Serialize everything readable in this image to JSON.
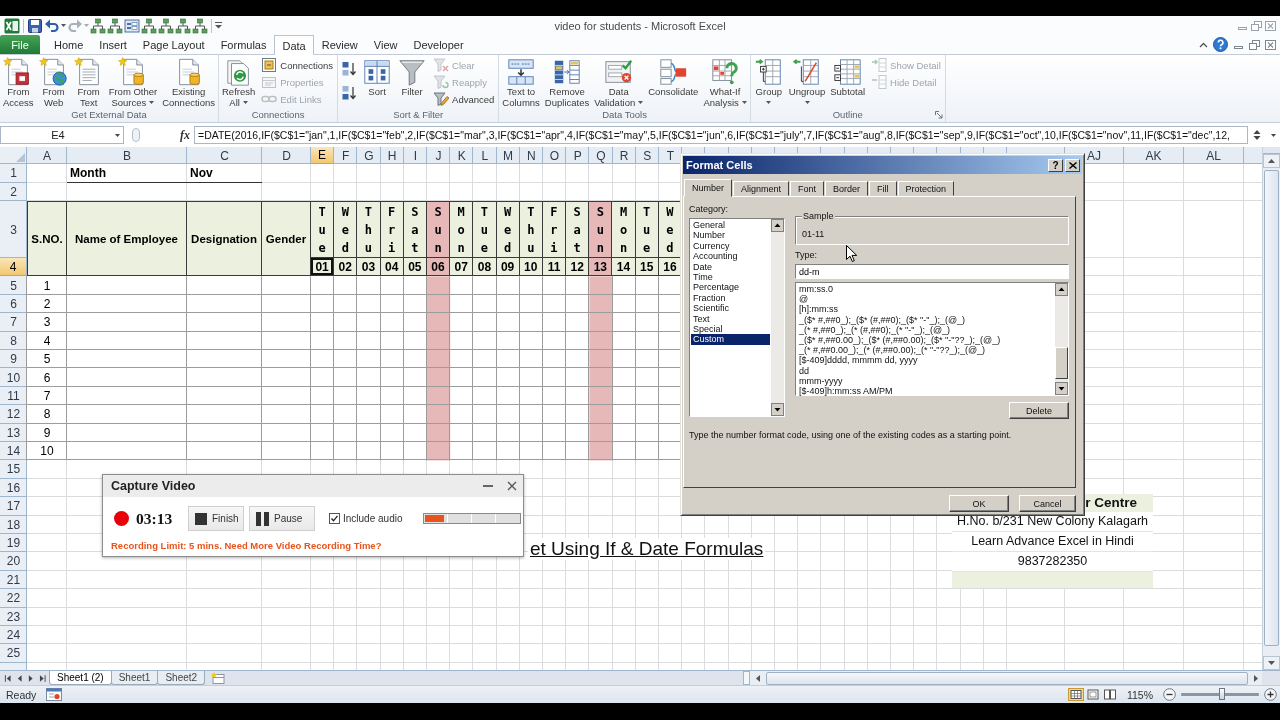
{
  "window": {
    "title": "video for students - Microsoft Excel"
  },
  "ribbon_tabs": [
    {
      "label": "File",
      "kind": "backstage",
      "selected": false
    },
    {
      "label": "Home",
      "kind": "tab",
      "selected": false
    },
    {
      "label": "Insert",
      "kind": "tab",
      "selected": false
    },
    {
      "label": "Page Layout",
      "kind": "tab",
      "selected": false
    },
    {
      "label": "Formulas",
      "kind": "tab",
      "selected": false
    },
    {
      "label": "Data",
      "kind": "tab",
      "selected": true
    },
    {
      "label": "Review",
      "kind": "tab",
      "selected": false
    },
    {
      "label": "View",
      "kind": "tab",
      "selected": false
    },
    {
      "label": "Developer",
      "kind": "tab",
      "selected": false
    }
  ],
  "ribbon_groups": [
    {
      "label": "Get External Data",
      "launcher": false,
      "items": [
        {
          "kind": "large",
          "label": "From\nAccess",
          "dropdown": false
        },
        {
          "kind": "large",
          "label": "From\nWeb",
          "dropdown": false
        },
        {
          "kind": "large",
          "label": "From\nText",
          "dropdown": false
        },
        {
          "kind": "large",
          "label": "From Other\nSources",
          "dropdown": true
        },
        {
          "kind": "large",
          "label": "Existing\nConnections",
          "dropdown": false
        }
      ]
    },
    {
      "label": "Connections",
      "launcher": false,
      "items": [
        {
          "kind": "large",
          "label": "Refresh\nAll",
          "dropdown": true
        },
        {
          "kind": "stack",
          "items": [
            {
              "label": "Connections",
              "disabled": false
            },
            {
              "label": "Properties",
              "disabled": true
            },
            {
              "label": "Edit Links",
              "disabled": true
            }
          ]
        }
      ]
    },
    {
      "label": "Sort & Filter",
      "launcher": false,
      "items": [
        {
          "kind": "sort_pair"
        },
        {
          "kind": "large",
          "label": "Sort",
          "dropdown": false
        },
        {
          "kind": "large",
          "label": "Filter",
          "dropdown": false
        },
        {
          "kind": "stack",
          "items": [
            {
              "label": "Clear",
              "disabled": true
            },
            {
              "label": "Reapply",
              "disabled": true
            },
            {
              "label": "Advanced",
              "disabled": false
            }
          ]
        }
      ]
    },
    {
      "label": "Data Tools",
      "launcher": false,
      "items": [
        {
          "kind": "large",
          "label": "Text to\nColumns",
          "dropdown": false
        },
        {
          "kind": "large",
          "label": "Remove\nDuplicates",
          "dropdown": false
        },
        {
          "kind": "large",
          "label": "Data\nValidation",
          "dropdown": true
        },
        {
          "kind": "large",
          "label": "Consolidate",
          "dropdown": false
        },
        {
          "kind": "large",
          "label": "What-If\nAnalysis",
          "dropdown": true
        }
      ]
    },
    {
      "label": "Outline",
      "launcher": true,
      "items": [
        {
          "kind": "large",
          "label": "Group",
          "dropdown": true
        },
        {
          "kind": "large",
          "label": "Ungroup",
          "dropdown": true
        },
        {
          "kind": "large",
          "label": "Subtotal",
          "dropdown": false
        },
        {
          "kind": "stack",
          "items": [
            {
              "label": "Show Detail",
              "disabled": true
            },
            {
              "label": "Hide Detail",
              "disabled": true
            }
          ]
        }
      ]
    }
  ],
  "formula_bar": {
    "name_box": "E4",
    "function_button": "fx",
    "formula": "=DATE(2016,IF($C$1=\"jan\",1,IF($C$1=\"feb\",2,IF($C$1=\"mar\",3,IF($C$1=\"apr\",4,IF($C$1=\"may\",5,IF($C$1=\"jun\",6,IF($C$1=\"july\",7,IF($C$1=\"aug\",8,IF($C$1=\"sep\",9,IF($C$1=\"oct\",10,IF($C$1=\"nov\",11,IF($C$1=\"dec\",12,"
  },
  "sheet": {
    "column_headers": [
      {
        "label": "A",
        "selected": false
      },
      {
        "label": "B",
        "selected": false
      },
      {
        "label": "C",
        "selected": false
      },
      {
        "label": "D",
        "selected": false
      },
      {
        "label": "E",
        "selected": true
      },
      {
        "label": "F",
        "selected": false
      },
      {
        "label": "G",
        "selected": false
      },
      {
        "label": "H",
        "selected": false
      },
      {
        "label": "I",
        "selected": false
      },
      {
        "label": "J",
        "selected": false
      },
      {
        "label": "K",
        "selected": false
      },
      {
        "label": "L",
        "selected": false
      },
      {
        "label": "M",
        "selected": false
      },
      {
        "label": "N",
        "selected": false
      },
      {
        "label": "O",
        "selected": false
      },
      {
        "label": "P",
        "selected": false
      },
      {
        "label": "Q",
        "selected": false
      },
      {
        "label": "R",
        "selected": false
      },
      {
        "label": "S",
        "selected": false
      },
      {
        "label": "T",
        "selected": false
      }
    ],
    "far_column_headers": [
      {
        "label": "AJ",
        "selected": false
      },
      {
        "label": "AK",
        "selected": false
      },
      {
        "label": "AL",
        "selected": false
      }
    ],
    "row_headers": [
      {
        "label": "1",
        "selected": false
      },
      {
        "label": "2",
        "selected": false
      },
      {
        "label": "3",
        "selected": false
      },
      {
        "label": "4",
        "selected": true
      },
      {
        "label": "5",
        "selected": false
      },
      {
        "label": "6",
        "selected": false
      },
      {
        "label": "7",
        "selected": false
      },
      {
        "label": "8",
        "selected": false
      },
      {
        "label": "9",
        "selected": false
      },
      {
        "label": "10",
        "selected": false
      },
      {
        "label": "11",
        "selected": false
      },
      {
        "label": "12",
        "selected": false
      },
      {
        "label": "13",
        "selected": false
      },
      {
        "label": "14",
        "selected": false
      },
      {
        "label": "15",
        "selected": false
      },
      {
        "label": "16",
        "selected": false
      },
      {
        "label": "17",
        "selected": false
      },
      {
        "label": "18",
        "selected": false
      },
      {
        "label": "19",
        "selected": false
      },
      {
        "label": "20",
        "selected": false
      },
      {
        "label": "21",
        "selected": false
      },
      {
        "label": "22",
        "selected": false
      },
      {
        "label": "23",
        "selected": false
      },
      {
        "label": "24",
        "selected": false
      },
      {
        "label": "25",
        "selected": false
      }
    ],
    "month_label": "Month",
    "month_value": "Nov",
    "table_headers": [
      "S.NO.",
      "Name of Employee",
      "Designation",
      "Gender"
    ],
    "days": [
      {
        "day": "Tue",
        "date": "01",
        "highlighted": false,
        "selected": true
      },
      {
        "day": "Wed",
        "date": "02",
        "highlighted": false,
        "selected": false
      },
      {
        "day": "Thu",
        "date": "03",
        "highlighted": false,
        "selected": false
      },
      {
        "day": "Fri",
        "date": "04",
        "highlighted": false,
        "selected": false
      },
      {
        "day": "Sat",
        "date": "05",
        "highlighted": false,
        "selected": false
      },
      {
        "day": "Sun",
        "date": "06",
        "highlighted": true,
        "selected": false
      },
      {
        "day": "Mon",
        "date": "07",
        "highlighted": false,
        "selected": false
      },
      {
        "day": "Tue",
        "date": "08",
        "highlighted": false,
        "selected": false
      },
      {
        "day": "Wed",
        "date": "09",
        "highlighted": false,
        "selected": false
      },
      {
        "day": "Thu",
        "date": "10",
        "highlighted": false,
        "selected": false
      },
      {
        "day": "Fri",
        "date": "11",
        "highlighted": false,
        "selected": false
      },
      {
        "day": "Sat",
        "date": "12",
        "highlighted": false,
        "selected": false
      },
      {
        "day": "Sun",
        "date": "13",
        "highlighted": true,
        "selected": false
      },
      {
        "day": "Mon",
        "date": "14",
        "highlighted": false,
        "selected": false
      },
      {
        "day": "Tue",
        "date": "15",
        "highlighted": false,
        "selected": false
      },
      {
        "day": "Wed",
        "date": "16",
        "highlighted": false,
        "selected": false
      }
    ],
    "serial_numbers": [
      "1",
      "2",
      "3",
      "4",
      "5",
      "6",
      "7",
      "8",
      "9",
      "10"
    ],
    "heading": "et Using If & Date Formulas",
    "contact_box": {
      "title": "r Centre",
      "lines": [
        "H.No. b/231 New Colony Kalagarh",
        "Learn Advance Excel in Hindi",
        "9837282350"
      ]
    }
  },
  "sheet_tabs": [
    {
      "label": "Sheet1 (2)",
      "selected": true
    },
    {
      "label": "Sheet1",
      "selected": false
    },
    {
      "label": "Sheet2",
      "selected": false
    }
  ],
  "status_bar": {
    "mode": "Ready",
    "view_buttons": [
      {
        "selected": true
      },
      {
        "selected": false
      },
      {
        "selected": false
      }
    ],
    "zoom": {
      "reading": "115%",
      "level": 0.52
    }
  },
  "format_dialog": {
    "title": "Format Cells",
    "help_button": "?",
    "tabs": [
      {
        "label": "Number",
        "selected": true
      },
      {
        "label": "Alignment",
        "selected": false
      },
      {
        "label": "Font",
        "selected": false
      },
      {
        "label": "Border",
        "selected": false
      },
      {
        "label": "Fill",
        "selected": false
      },
      {
        "label": "Protection",
        "selected": false
      }
    ],
    "category_label": "Category:",
    "categories": [
      {
        "label": "General",
        "selected": false
      },
      {
        "label": "Number",
        "selected": false
      },
      {
        "label": "Currency",
        "selected": false
      },
      {
        "label": "Accounting",
        "selected": false
      },
      {
        "label": "Date",
        "selected": false
      },
      {
        "label": "Time",
        "selected": false
      },
      {
        "label": "Percentage",
        "selected": false
      },
      {
        "label": "Fraction",
        "selected": false
      },
      {
        "label": "Scientific",
        "selected": false
      },
      {
        "label": "Text",
        "selected": false
      },
      {
        "label": "Special",
        "selected": false
      },
      {
        "label": "Custom",
        "selected": true
      }
    ],
    "sample_label": "Sample",
    "sample_value": "01-11",
    "type_label": "Type:",
    "type_value": "dd-m",
    "formats": [
      "mm:ss.0",
      "@",
      "[h]:mm:ss",
      "_($* #,##0_);_($* (#,##0);_($* \"-\"_);_(@_)",
      "_(* #,##0_);_(* (#,##0);_(* \"-\"_);_(@_)",
      "_($* #,##0.00_);_($* (#,##0.00);_($* \"-\"??_);_(@_)",
      "_(* #,##0.00_);_(* (#,##0.00);_(* \"-\"??_);_(@_)",
      "[$-409]dddd, mmmm dd, yyyy",
      "dd",
      "mmm-yyyy",
      "[$-409]h:mm:ss AM/PM"
    ],
    "delete_button": "Delete",
    "hint": "Type the number format code, using one of the existing codes as a starting point.",
    "buttons": [
      "OK",
      "Cancel"
    ]
  },
  "capture_window": {
    "title": "Capture Video",
    "timer": "03:13",
    "buttons": [
      "Finish",
      "Pause"
    ],
    "include_audio": {
      "label": "Include audio",
      "checked": true
    },
    "audio_meter": {
      "level": 0.2
    },
    "notice": "Recording Limit: 5 mins. Need More Video Recording Time?"
  }
}
